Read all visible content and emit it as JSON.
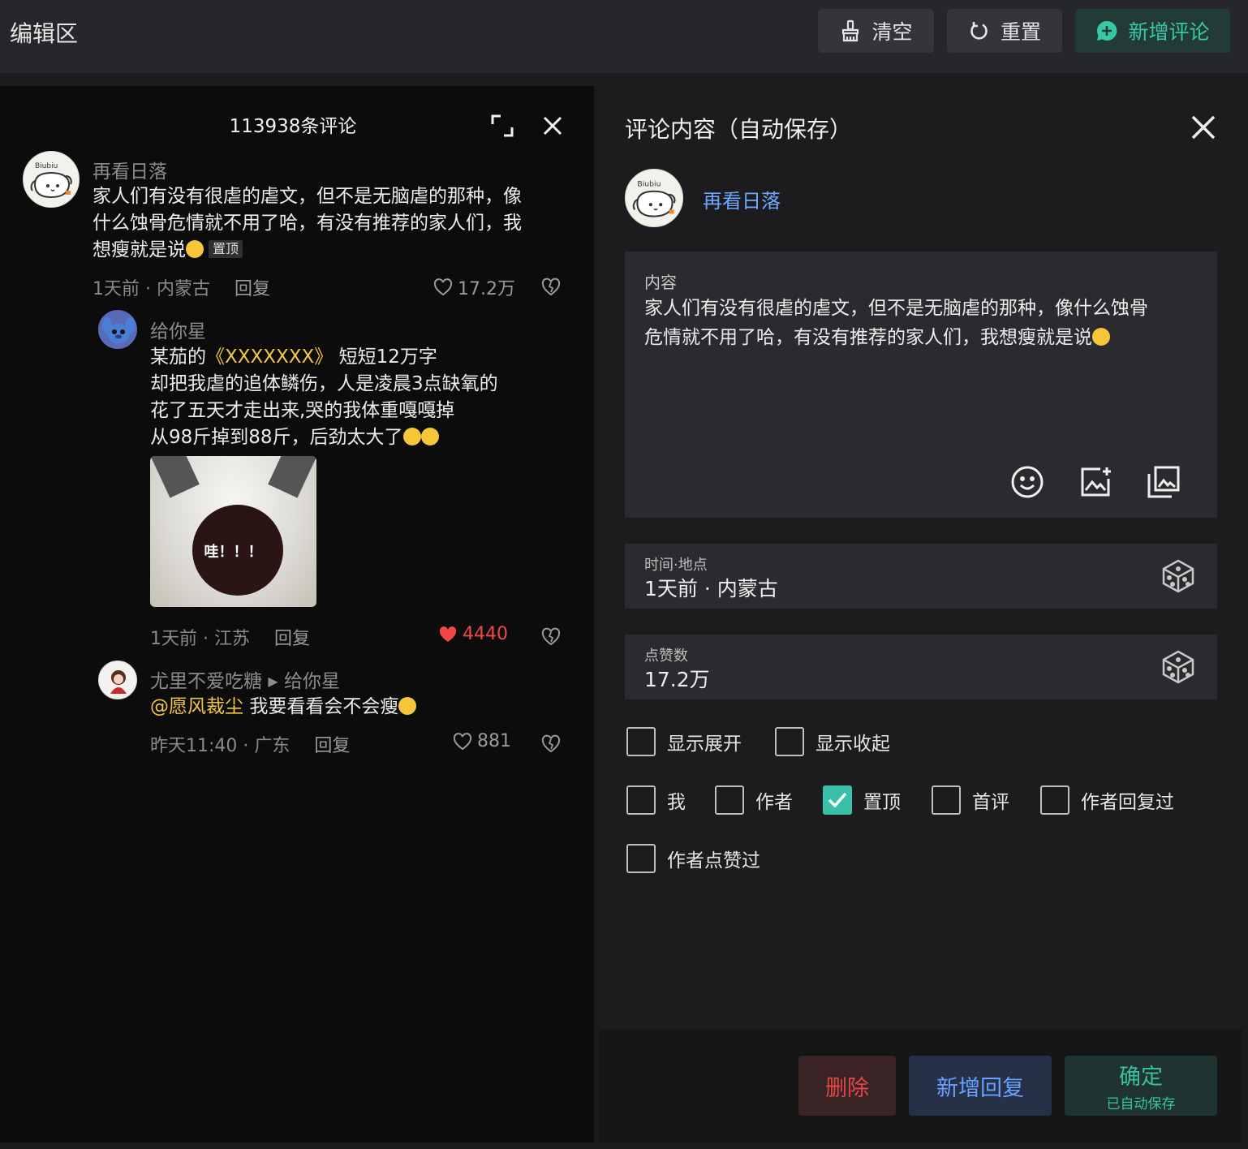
{
  "topbar": {
    "title": "编辑区",
    "buttons": {
      "clear": "清空",
      "reset": "重置",
      "add_comment": "新增评论"
    },
    "accent": "#38c8a6"
  },
  "preview": {
    "header": "113938条评论",
    "comments": [
      {
        "user": "再看日落",
        "avatar_text": "Biubiu",
        "text_lines": [
          "家人们有没有很虐的虐文，但不是无脑虐的那种，像",
          "什么蚀骨危情就不用了哈，有没有推荐的家人们，我",
          "想瘦就是说"
        ],
        "pin": "置顶",
        "time": "1天前 · 内蒙古",
        "reply": "回复",
        "likes": "17.2万"
      },
      {
        "user": "给你星",
        "line1_prefix": "某茄的",
        "line1_book": "《XXXXXXX》",
        "line1_suffix": "短短12万字",
        "text_lines": [
          "却把我虐的追体鳞伤，人是凌晨3点缺氧的",
          "花了五天才走出来,哭的我体重嘎嘎掉",
          "从98斤掉到88斤，后劲太大了"
        ],
        "image_text": "哇！！！",
        "time": "1天前 · 江苏",
        "reply": "回复",
        "likes": "4440",
        "liked_color": "#f04848"
      },
      {
        "user": "尤里不爱吃糖",
        "reply_to": "给你星",
        "mention": "@愿风裁尘",
        "text": "我要看看会不会瘦",
        "time": "昨天11:40 · 广东",
        "reply": "回复",
        "likes": "881"
      }
    ]
  },
  "editor": {
    "title": "评论内容（自动保存）",
    "user": "再看日落",
    "content_label": "内容",
    "content_lines": [
      "家人们有没有很虐的虐文，但不是无脑虐的那种，像什么蚀骨",
      "危情就不用了哈，有没有推荐的家人们，我想瘦就是说"
    ],
    "time_label": "时间·地点",
    "time_value": "1天前 · 内蒙古",
    "likes_label": "点赞数",
    "likes_value": "17.2万",
    "checkboxes": {
      "show_expand": "显示展开",
      "show_collapse": "显示收起",
      "me": "我",
      "author": "作者",
      "pinned": "置顶",
      "first": "首评",
      "author_replied": "作者回复过",
      "author_liked": "作者点赞过"
    },
    "checked": {
      "pinned": true
    }
  },
  "footer": {
    "delete": "删除",
    "add_reply": "新增回复",
    "confirm": "确定",
    "confirm_sub": "已自动保存"
  }
}
